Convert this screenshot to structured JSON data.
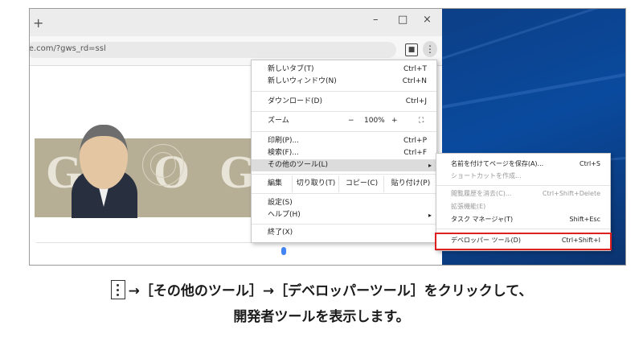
{
  "browser": {
    "new_tab_glyph": "+",
    "minimize_glyph": "–",
    "maximize_glyph": "□",
    "close_glyph": "×",
    "url": "le.com/?gws_rd=ssl",
    "kebab_glyph": "⋮",
    "profile_glyph": "■"
  },
  "menu": {
    "items": [
      {
        "label": "新しいタブ(T)",
        "shortcut": "Ctrl+T"
      },
      {
        "label": "新しいウィンドウ(N)",
        "shortcut": "Ctrl+N"
      },
      {
        "label": "ダウンロード(D)",
        "shortcut": "Ctrl+J"
      },
      {
        "label": "ズーム",
        "shortcut": ""
      },
      {
        "label": "印刷(P)...",
        "shortcut": "Ctrl+P"
      },
      {
        "label": "検索(F)...",
        "shortcut": "Ctrl+F"
      },
      {
        "label": "その他のツール(L)",
        "shortcut": ""
      },
      {
        "label": "設定(S)",
        "shortcut": ""
      },
      {
        "label": "ヘルプ(H)",
        "shortcut": ""
      },
      {
        "label": "終了(X)",
        "shortcut": ""
      }
    ],
    "zoom": {
      "minus": "−",
      "value": "100%",
      "plus": "+",
      "fullscreen": "⛶"
    },
    "edit_row": [
      "編集",
      "切り取り(T)",
      "コピー(C)",
      "貼り付け(P)"
    ],
    "submenu_arrow": "▸"
  },
  "submenu": {
    "items": [
      {
        "label": "名前を付けてページを保存(A)...",
        "shortcut": "Ctrl+S",
        "dim": false
      },
      {
        "label": "ショートカットを作成...",
        "shortcut": "",
        "dim": true
      },
      {
        "label": "閲覧履歴を消去(C)...",
        "shortcut": "Ctrl+Shift+Delete",
        "dim": true
      },
      {
        "label": "拡張機能(E)",
        "shortcut": "",
        "dim": true
      },
      {
        "label": "タスク マネージャ(T)",
        "shortcut": "Shift+Esc",
        "dim": false
      },
      {
        "label": "デベロッパー ツール(D)",
        "shortcut": "Ctrl+Shift+I",
        "dim": false
      }
    ]
  },
  "caption": {
    "line1": "→［その他のツール］→［デベロッパーツール］をクリックして、",
    "line2": "開発者ツールを表示します。"
  },
  "colors": {
    "highlight_box": "#e0201f",
    "desktop": "#0a4a9e"
  }
}
